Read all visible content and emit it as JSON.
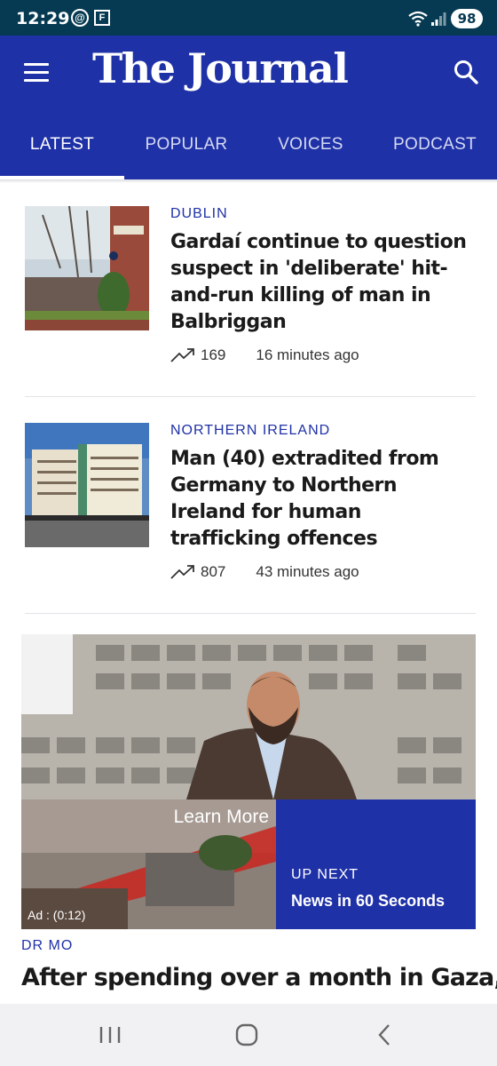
{
  "status_bar": {
    "time": "12:29",
    "app_icon_f": "F",
    "battery": "98"
  },
  "header": {
    "logo": "The Journal",
    "brand_color": "#1f31a7"
  },
  "tabs": [
    {
      "label": "LATEST",
      "active": true
    },
    {
      "label": "POPULAR",
      "active": false
    },
    {
      "label": "VOICES",
      "active": false
    },
    {
      "label": "PODCAST",
      "active": false
    }
  ],
  "articles": [
    {
      "category": "DUBLIN",
      "headline": "Gardaí continue to question suspect in 'deliberate' hit-and-run killing of man in Balbriggan",
      "trend_count": "169",
      "time": "16 minutes ago"
    },
    {
      "category": "NORTHERN IRELAND",
      "headline": "Man (40) extradited from Germany to Northern Ireland for human trafficking offences",
      "trend_count": "807",
      "time": "43 minutes ago"
    }
  ],
  "video": {
    "learn_more": "Learn More",
    "ad_label": "Ad : (0:12)",
    "up_next_label": "UP NEXT",
    "up_next_title": "News in 60 Seconds"
  },
  "article3": {
    "category": "DR MO",
    "headline": "After spending over a month in Gaza,"
  }
}
